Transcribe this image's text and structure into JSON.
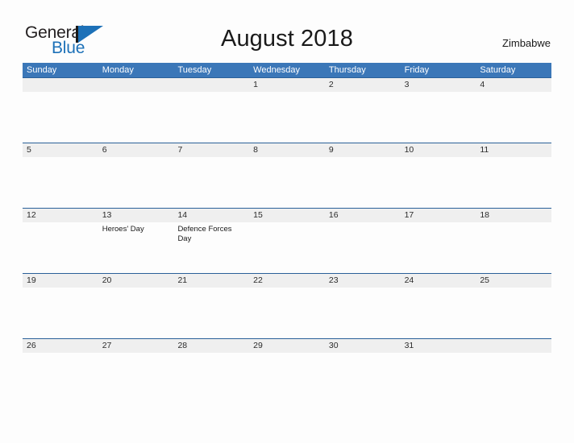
{
  "brand": {
    "name_part1": "General",
    "name_part2": "Blue",
    "mark_icon": "flag-triangle-icon"
  },
  "header": {
    "title": "August 2018",
    "country": "Zimbabwe"
  },
  "calendar": {
    "month": "August",
    "year": "2018",
    "weekday_headers": [
      "Sunday",
      "Monday",
      "Tuesday",
      "Wednesday",
      "Thursday",
      "Friday",
      "Saturday"
    ],
    "colors": {
      "header_blue": "#3b77b8",
      "rule_blue": "#2a6099",
      "number_band": "#efefef",
      "logo_blue": "#1d71b8"
    },
    "weeks": [
      {
        "days": [
          {
            "number": "",
            "event": ""
          },
          {
            "number": "",
            "event": ""
          },
          {
            "number": "",
            "event": ""
          },
          {
            "number": "1",
            "event": ""
          },
          {
            "number": "2",
            "event": ""
          },
          {
            "number": "3",
            "event": ""
          },
          {
            "number": "4",
            "event": ""
          }
        ]
      },
      {
        "days": [
          {
            "number": "5",
            "event": ""
          },
          {
            "number": "6",
            "event": ""
          },
          {
            "number": "7",
            "event": ""
          },
          {
            "number": "8",
            "event": ""
          },
          {
            "number": "9",
            "event": ""
          },
          {
            "number": "10",
            "event": ""
          },
          {
            "number": "11",
            "event": ""
          }
        ]
      },
      {
        "days": [
          {
            "number": "12",
            "event": ""
          },
          {
            "number": "13",
            "event": "Heroes' Day"
          },
          {
            "number": "14",
            "event": "Defence Forces Day"
          },
          {
            "number": "15",
            "event": ""
          },
          {
            "number": "16",
            "event": ""
          },
          {
            "number": "17",
            "event": ""
          },
          {
            "number": "18",
            "event": ""
          }
        ]
      },
      {
        "days": [
          {
            "number": "19",
            "event": ""
          },
          {
            "number": "20",
            "event": ""
          },
          {
            "number": "21",
            "event": ""
          },
          {
            "number": "22",
            "event": ""
          },
          {
            "number": "23",
            "event": ""
          },
          {
            "number": "24",
            "event": ""
          },
          {
            "number": "25",
            "event": ""
          }
        ]
      },
      {
        "days": [
          {
            "number": "26",
            "event": ""
          },
          {
            "number": "27",
            "event": ""
          },
          {
            "number": "28",
            "event": ""
          },
          {
            "number": "29",
            "event": ""
          },
          {
            "number": "30",
            "event": ""
          },
          {
            "number": "31",
            "event": ""
          },
          {
            "number": "",
            "event": ""
          }
        ]
      }
    ]
  }
}
